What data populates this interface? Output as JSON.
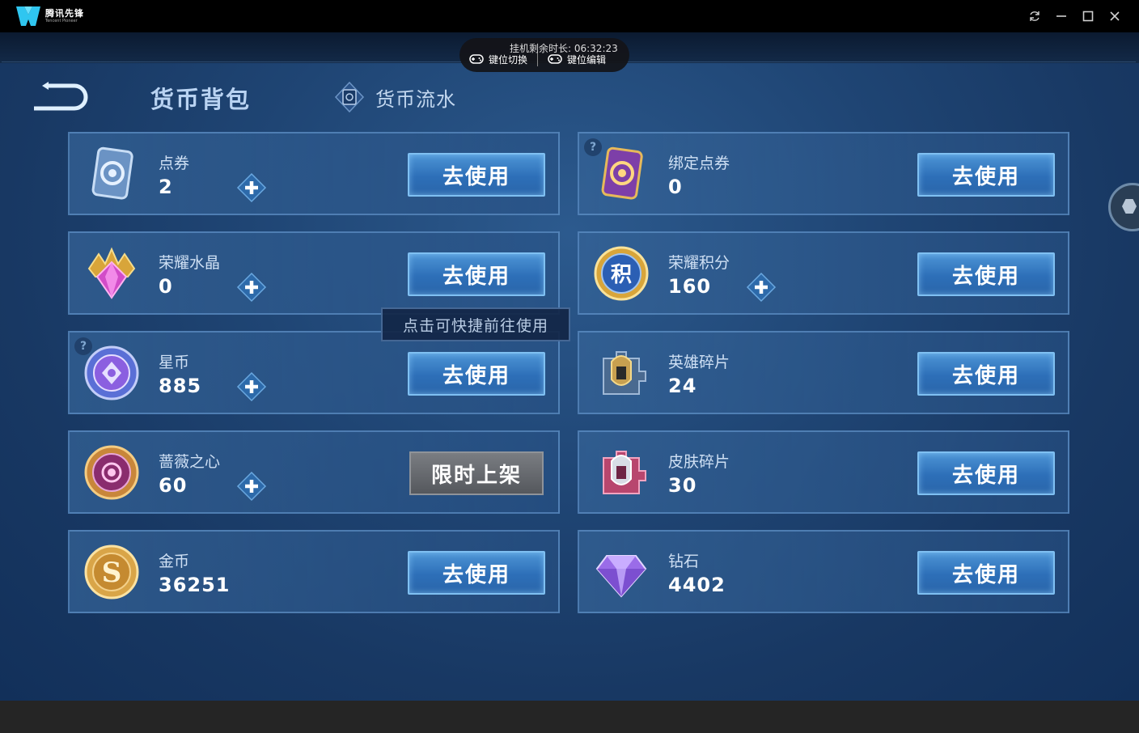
{
  "window": {
    "app_name": "腾讯先锋",
    "app_name_en": "Tencent Pioneer",
    "controls": [
      "refresh-icon",
      "minimize-icon",
      "maximize-icon",
      "close-icon"
    ]
  },
  "toolbar": {
    "timer": "挂机剩余时长: 06:32:23",
    "key_switch": "键位切换",
    "key_edit": "键位编辑"
  },
  "header": {
    "active_tab": "货币背包",
    "flow_tab": "货币流水"
  },
  "tooltip": "点击可快捷前往使用",
  "use_label": "去使用",
  "limited_label": "限时上架",
  "currencies": [
    {
      "name": "点券",
      "amount": "2",
      "icon": "voucher-card-icon"
    },
    {
      "name": "绑定点券",
      "amount": "0",
      "icon": "bound-voucher-card-icon"
    },
    {
      "name": "荣耀水晶",
      "amount": "0",
      "icon": "glory-crystal-icon"
    },
    {
      "name": "荣耀积分",
      "amount": "160",
      "icon": "glory-points-icon"
    },
    {
      "name": "星币",
      "amount": "885",
      "icon": "star-coin-icon"
    },
    {
      "name": "英雄碎片",
      "amount": "24",
      "icon": "hero-fragment-icon"
    },
    {
      "name": "蔷薇之心",
      "amount": "60",
      "icon": "rose-heart-icon"
    },
    {
      "name": "皮肤碎片",
      "amount": "30",
      "icon": "skin-fragment-icon"
    },
    {
      "name": "金币",
      "amount": "36251",
      "icon": "gold-coin-icon"
    },
    {
      "name": "钻石",
      "amount": "4402",
      "icon": "diamond-icon"
    }
  ],
  "colors": {
    "accent_button": "#2d6fb8",
    "card_bg": "#345f96",
    "background": "#1f4574"
  }
}
